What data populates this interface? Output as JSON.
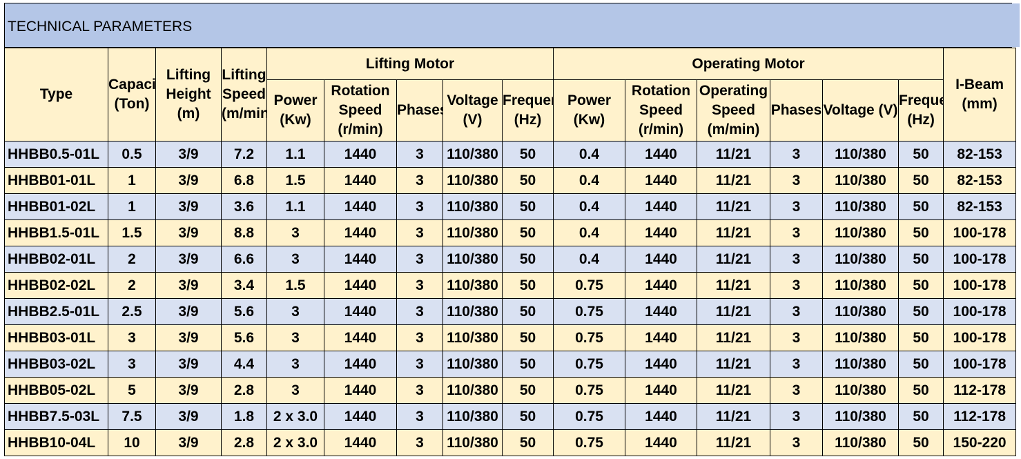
{
  "title": "TECHNICAL PARAMETERS",
  "colors": {
    "title_bg": "#b4c6e7",
    "header_bg": "#fff2cc",
    "row_blue": "#d9e1f2",
    "row_yellow": "#fff2cc",
    "border": "#000000"
  },
  "headers": {
    "type": "Type",
    "capacity": "Capacity (Ton)",
    "lifting_height": "Lifting Height (m)",
    "lifting_speed": "Lifting Speed (m/min)",
    "lifting_motor": {
      "label": "Lifting Motor",
      "power": "Power (Kw)",
      "rotation_speed": "Rotation Speed (r/min)",
      "phases": "Phases",
      "voltage": "Voltage (V)",
      "frequency": "Frequency (Hz)"
    },
    "operating_motor": {
      "label": "Operating Motor",
      "power": "Power (Kw)",
      "rotation_speed": "Rotation Speed (r/min)",
      "operating_speed": "Operating Speed (m/min)",
      "phases": "Phases",
      "voltage": "Voltage (V)",
      "frequency": "Frequency (Hz)"
    },
    "i_beam": "I-Beam (mm)"
  },
  "rows": [
    [
      "HHBB0.5-01L",
      "0.5",
      "3/9",
      "7.2",
      "1.1",
      "1440",
      "3",
      "110/380",
      "50",
      "0.4",
      "1440",
      "11/21",
      "3",
      "110/380",
      "50",
      "82-153"
    ],
    [
      "HHBB01-01L",
      "1",
      "3/9",
      "6.8",
      "1.5",
      "1440",
      "3",
      "110/380",
      "50",
      "0.4",
      "1440",
      "11/21",
      "3",
      "110/380",
      "50",
      "82-153"
    ],
    [
      "HHBB01-02L",
      "1",
      "3/9",
      "3.6",
      "1.1",
      "1440",
      "3",
      "110/380",
      "50",
      "0.4",
      "1440",
      "11/21",
      "3",
      "110/380",
      "50",
      "82-153"
    ],
    [
      "HHBB1.5-01L",
      "1.5",
      "3/9",
      "8.8",
      "3",
      "1440",
      "3",
      "110/380",
      "50",
      "0.4",
      "1440",
      "11/21",
      "3",
      "110/380",
      "50",
      "100-178"
    ],
    [
      "HHBB02-01L",
      "2",
      "3/9",
      "6.6",
      "3",
      "1440",
      "3",
      "110/380",
      "50",
      "0.4",
      "1440",
      "11/21",
      "3",
      "110/380",
      "50",
      "100-178"
    ],
    [
      "HHBB02-02L",
      "2",
      "3/9",
      "3.4",
      "1.5",
      "1440",
      "3",
      "110/380",
      "50",
      "0.75",
      "1440",
      "11/21",
      "3",
      "110/380",
      "50",
      "100-178"
    ],
    [
      "HHBB2.5-01L",
      "2.5",
      "3/9",
      "5.6",
      "3",
      "1440",
      "3",
      "110/380",
      "50",
      "0.75",
      "1440",
      "11/21",
      "3",
      "110/380",
      "50",
      "100-178"
    ],
    [
      "HHBB03-01L",
      "3",
      "3/9",
      "5.6",
      "3",
      "1440",
      "3",
      "110/380",
      "50",
      "0.75",
      "1440",
      "11/21",
      "3",
      "110/380",
      "50",
      "100-178"
    ],
    [
      "HHBB03-02L",
      "3",
      "3/9",
      "4.4",
      "3",
      "1440",
      "3",
      "110/380",
      "50",
      "0.75",
      "1440",
      "11/21",
      "3",
      "110/380",
      "50",
      "100-178"
    ],
    [
      "HHBB05-02L",
      "5",
      "3/9",
      "2.8",
      "3",
      "1440",
      "3",
      "110/380",
      "50",
      "0.75",
      "1440",
      "11/21",
      "3",
      "110/380",
      "50",
      "112-178"
    ],
    [
      "HHBB7.5-03L",
      "7.5",
      "3/9",
      "1.8",
      "2 x 3.0",
      "1440",
      "3",
      "110/380",
      "50",
      "0.75",
      "1440",
      "11/21",
      "3",
      "110/380",
      "50",
      "112-178"
    ],
    [
      "HHBB10-04L",
      "10",
      "3/9",
      "2.8",
      "2 x 3.0",
      "1440",
      "3",
      "110/380",
      "50",
      "0.75",
      "1440",
      "11/21",
      "3",
      "110/380",
      "50",
      "150-220"
    ]
  ]
}
